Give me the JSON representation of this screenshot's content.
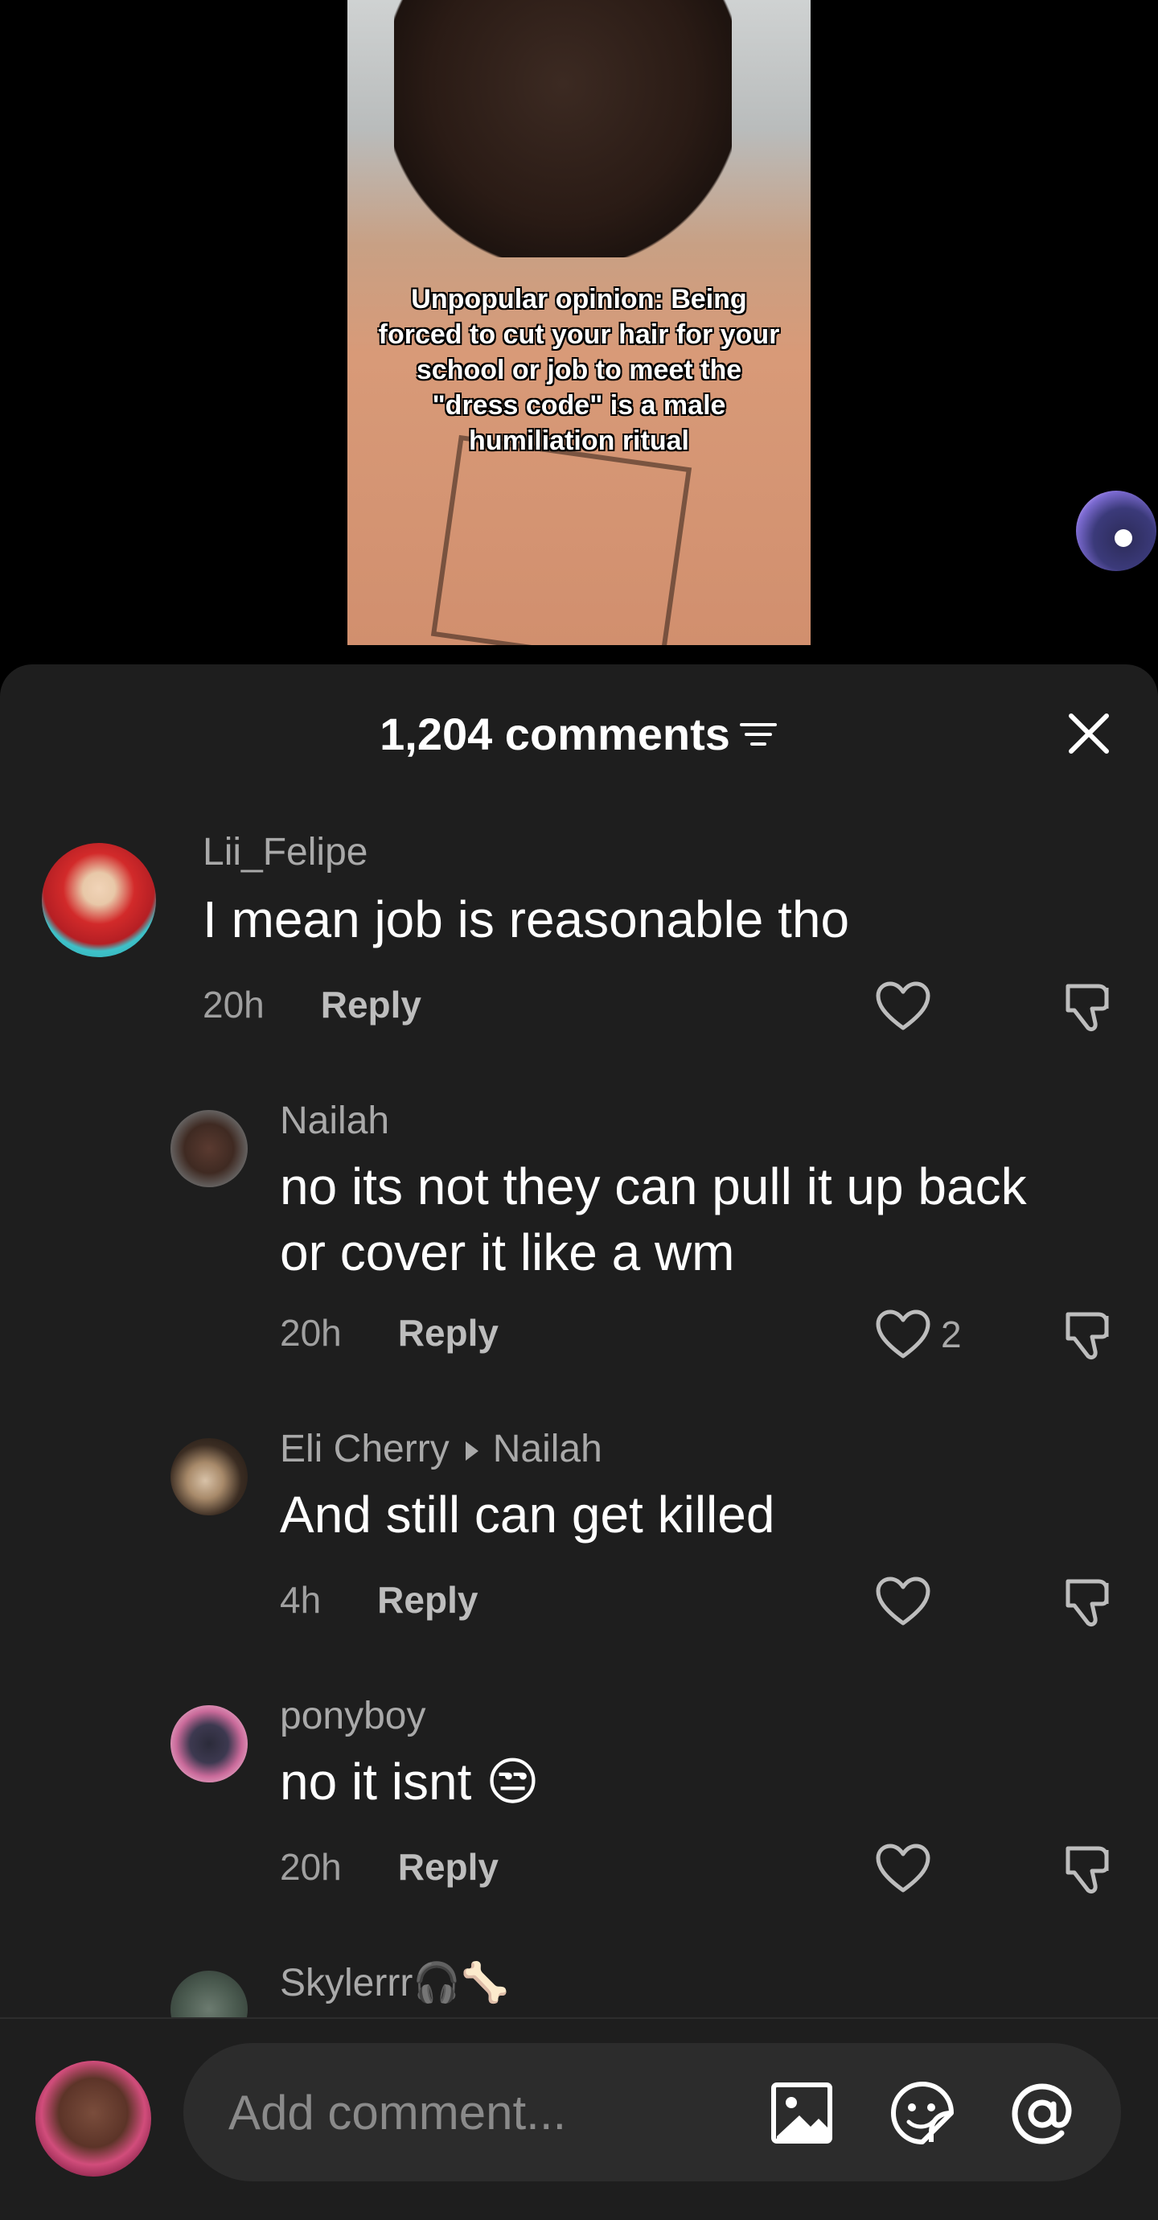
{
  "video": {
    "caption": "Unpopular opinion: Being forced to cut your hair for your school or job to meet the \"dress code\" is a male humiliation ritual"
  },
  "comments_header": {
    "count_label": "1,204 comments"
  },
  "comments": [
    {
      "user": "Lii_Felipe",
      "text": "I mean job is reasonable tho",
      "time": "20h",
      "reply": "Reply",
      "likes": ""
    },
    {
      "user": "Nailah",
      "text": "no its not they can pull it up back or cover it like a wm",
      "time": "20h",
      "reply": "Reply",
      "likes": "2"
    },
    {
      "user": "Eli Cherry",
      "reply_to": "Nailah",
      "text": "And still can get killed",
      "time": "4h",
      "reply": "Reply",
      "likes": ""
    },
    {
      "user": "ponyboy",
      "text": "no it isnt 😒",
      "time": "20h",
      "reply": "Reply",
      "likes": ""
    },
    {
      "user": "Skylerrr🎧🦴"
    }
  ],
  "composer": {
    "placeholder": "Add comment..."
  },
  "colors": {
    "sheet_bg": "#1e1e1e",
    "input_bg": "#2c2c2c",
    "muted_text": "#a9a9a9"
  },
  "icons": [
    "filter-icon",
    "close-icon",
    "heart-icon",
    "dislike-icon",
    "image-icon",
    "sticker-icon",
    "mention-icon"
  ]
}
